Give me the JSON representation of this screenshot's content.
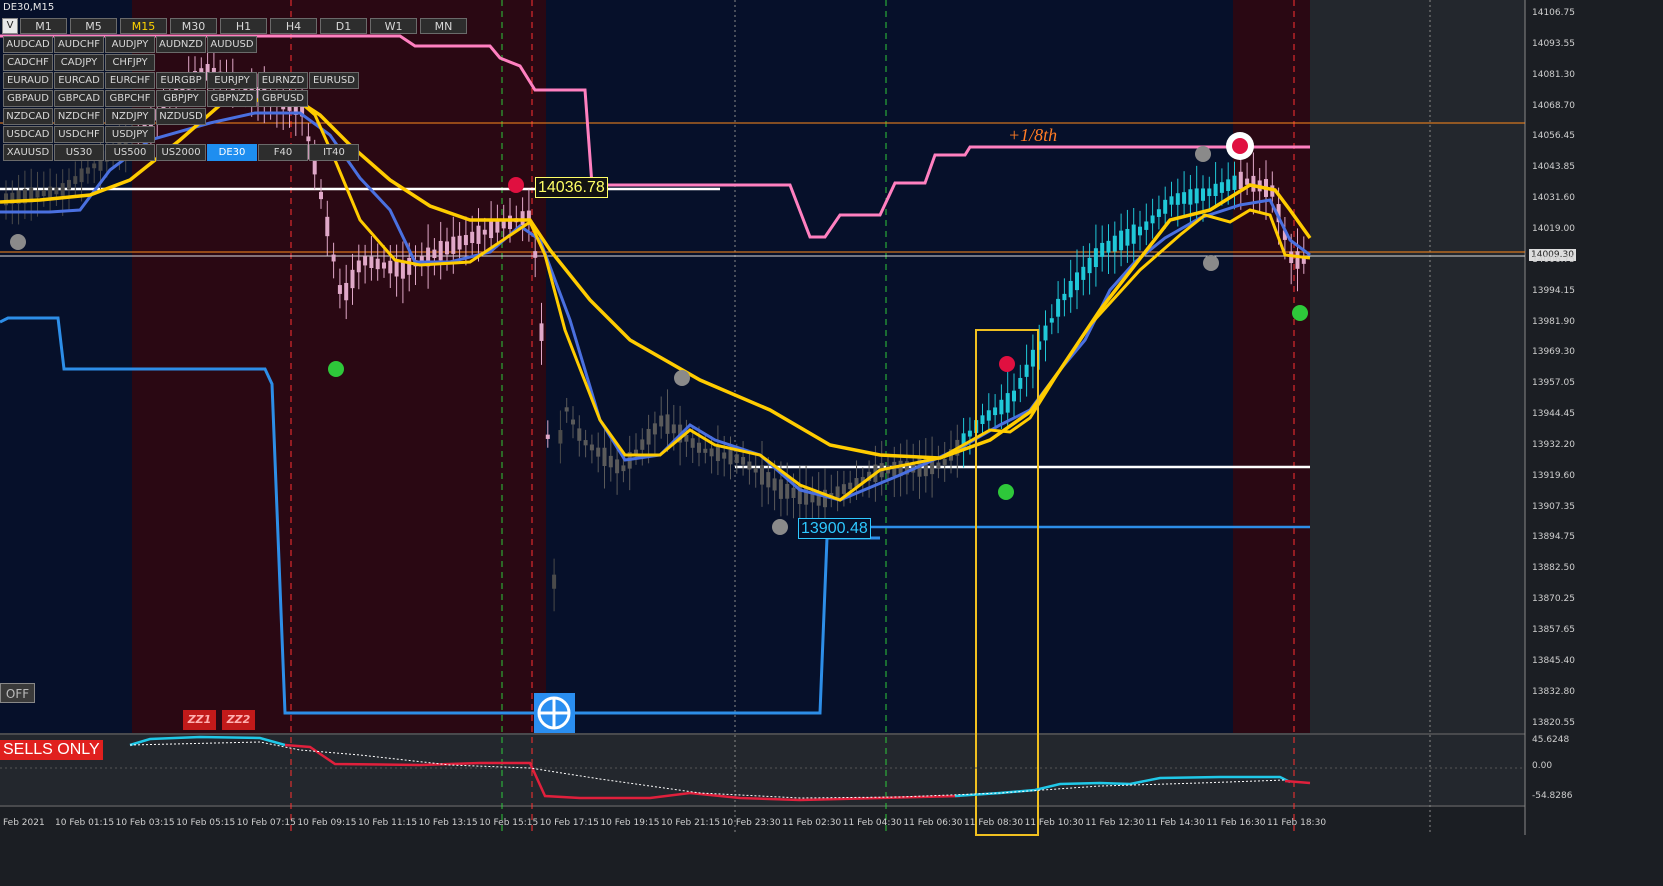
{
  "window": {
    "symbol_label": "DE30,M15"
  },
  "timeframes": [
    {
      "label": "M1",
      "active": false
    },
    {
      "label": "M5",
      "active": false
    },
    {
      "label": "M15",
      "active": true
    },
    {
      "label": "M30",
      "active": false
    },
    {
      "label": "H1",
      "active": false
    },
    {
      "label": "H4",
      "active": false
    },
    {
      "label": "D1",
      "active": false
    },
    {
      "label": "W1",
      "active": false
    },
    {
      "label": "MN",
      "active": false
    }
  ],
  "v_button": "V",
  "pairs": [
    [
      "AUDCAD",
      "AUDCHF",
      "AUDJPY",
      "AUDNZD",
      "AUDUSD",
      ""
    ],
    [
      "CADCHF",
      "CADJPY",
      "CHFJPY",
      "",
      "",
      ""
    ],
    [
      "EURAUD",
      "EURCAD",
      "EURCHF",
      "EURGBP",
      "EURJPY",
      "EURNZD",
      "EURUSD"
    ],
    [
      "GBPAUD",
      "GBPCAD",
      "GBPCHF",
      "GBPJPY",
      "GBPNZD",
      "GBPUSD"
    ],
    [
      "NZDCAD",
      "NZDCHF",
      "NZDJPY",
      "NZDUSD",
      "",
      ""
    ],
    [
      "USDCAD",
      "USDCHF",
      "USDJPY",
      "",
      "",
      ""
    ],
    [
      "XAUUSD",
      "US30",
      "US500",
      "US2000",
      "DE30",
      "F40",
      "IT40"
    ]
  ],
  "active_pair": "DE30",
  "off_button": "OFF",
  "zz_buttons": [
    "ZZ1",
    "ZZ2"
  ],
  "sells_only": "SELLS ONLY",
  "price_labels": {
    "high": "14036.78",
    "low": "13900.48",
    "eighth": "+1/8th"
  },
  "current_price_tag": "14009.30",
  "y_axis": [
    "14106.75",
    "14093.55",
    "14081.30",
    "14068.70",
    "14056.45",
    "14043.85",
    "14031.60",
    "14019.00",
    "14006.75",
    "13994.15",
    "13981.90",
    "13969.30",
    "13957.05",
    "13944.45",
    "13932.20",
    "13919.60",
    "13907.35",
    "13894.75",
    "13882.50",
    "13870.25",
    "13857.65",
    "13845.40",
    "13832.80",
    "13820.55"
  ],
  "oscillator_axis": [
    "45.6248",
    "0.00",
    "-54.8286"
  ],
  "x_axis": [
    "Feb 2021",
    "10 Feb 01:15",
    "10 Feb 03:15",
    "10 Feb 05:15",
    "10 Feb 07:15",
    "10 Feb 09:15",
    "10 Feb 11:15",
    "10 Feb 13:15",
    "10 Feb 15:15",
    "10 Feb 17:15",
    "10 Feb 19:15",
    "10 Feb 21:15",
    "10 Feb 23:30",
    "11 Feb 02:30",
    "11 Feb 04:30",
    "11 Feb 06:30",
    "11 Feb 08:30",
    "11 Feb 10:30",
    "11 Feb 12:30",
    "11 Feb 14:30",
    "11 Feb 16:30",
    "11 Feb 18:30"
  ],
  "colors": {
    "background": "#06102a",
    "sell_zone": "#2a0813",
    "bull": "#20c8d8",
    "bear": "#e0a8c8",
    "neutral": "#4a4a4a",
    "ema_fast": "#ffcc00",
    "ema_slow": "#3a6ae0",
    "upper": "#ff80c0",
    "lower": "#2d8ee8"
  }
}
